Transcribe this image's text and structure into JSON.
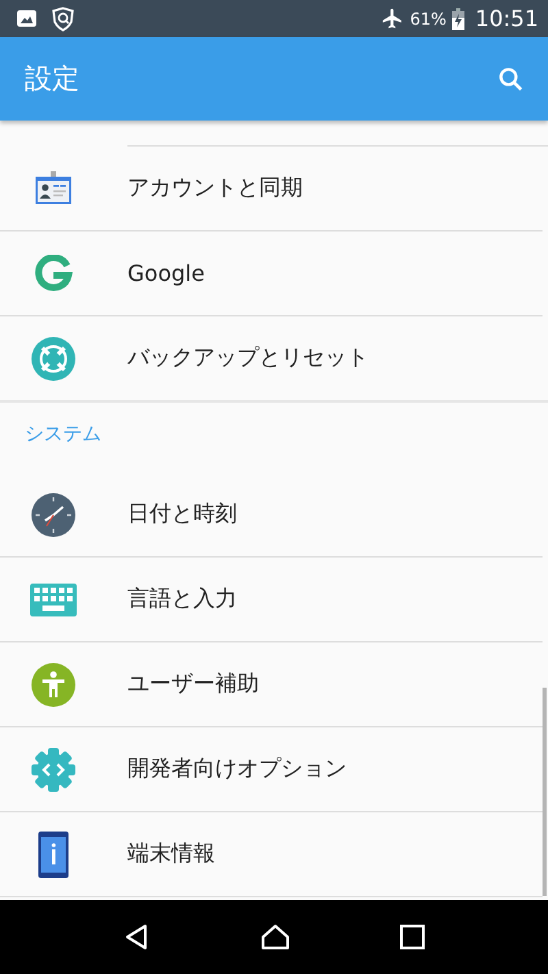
{
  "status_bar": {
    "battery": "61%",
    "time": "10:51"
  },
  "app_bar": {
    "title": "設定"
  },
  "sections": [
    {
      "items": [
        {
          "label": "アカウントと同期"
        },
        {
          "label": "Google"
        },
        {
          "label": "バックアップとリセット"
        }
      ]
    },
    {
      "header": "システム",
      "items": [
        {
          "label": "日付と時刻"
        },
        {
          "label": "言語と入力"
        },
        {
          "label": "ユーザー補助"
        },
        {
          "label": "開発者向けオプション"
        },
        {
          "label": "端末情報"
        }
      ]
    }
  ]
}
